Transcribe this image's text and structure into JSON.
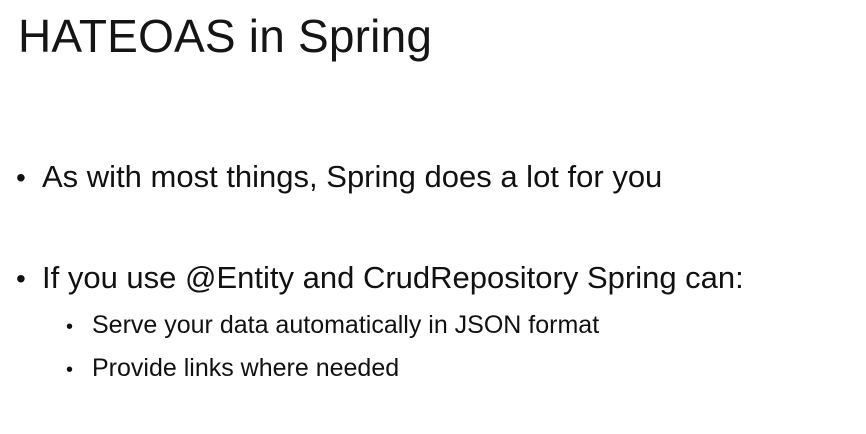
{
  "slide": {
    "title": "HATEOAS in Spring",
    "bullets": [
      {
        "marker": "•",
        "text": "As with most things, Spring does a lot for you"
      },
      {
        "marker": "•",
        "text": "If you use @Entity and CrudRepository Spring can:",
        "sub": [
          {
            "marker": "•",
            "text": "Serve your data automatically in JSON format"
          },
          {
            "marker": "•",
            "text": "Provide links where needed"
          }
        ]
      }
    ]
  }
}
